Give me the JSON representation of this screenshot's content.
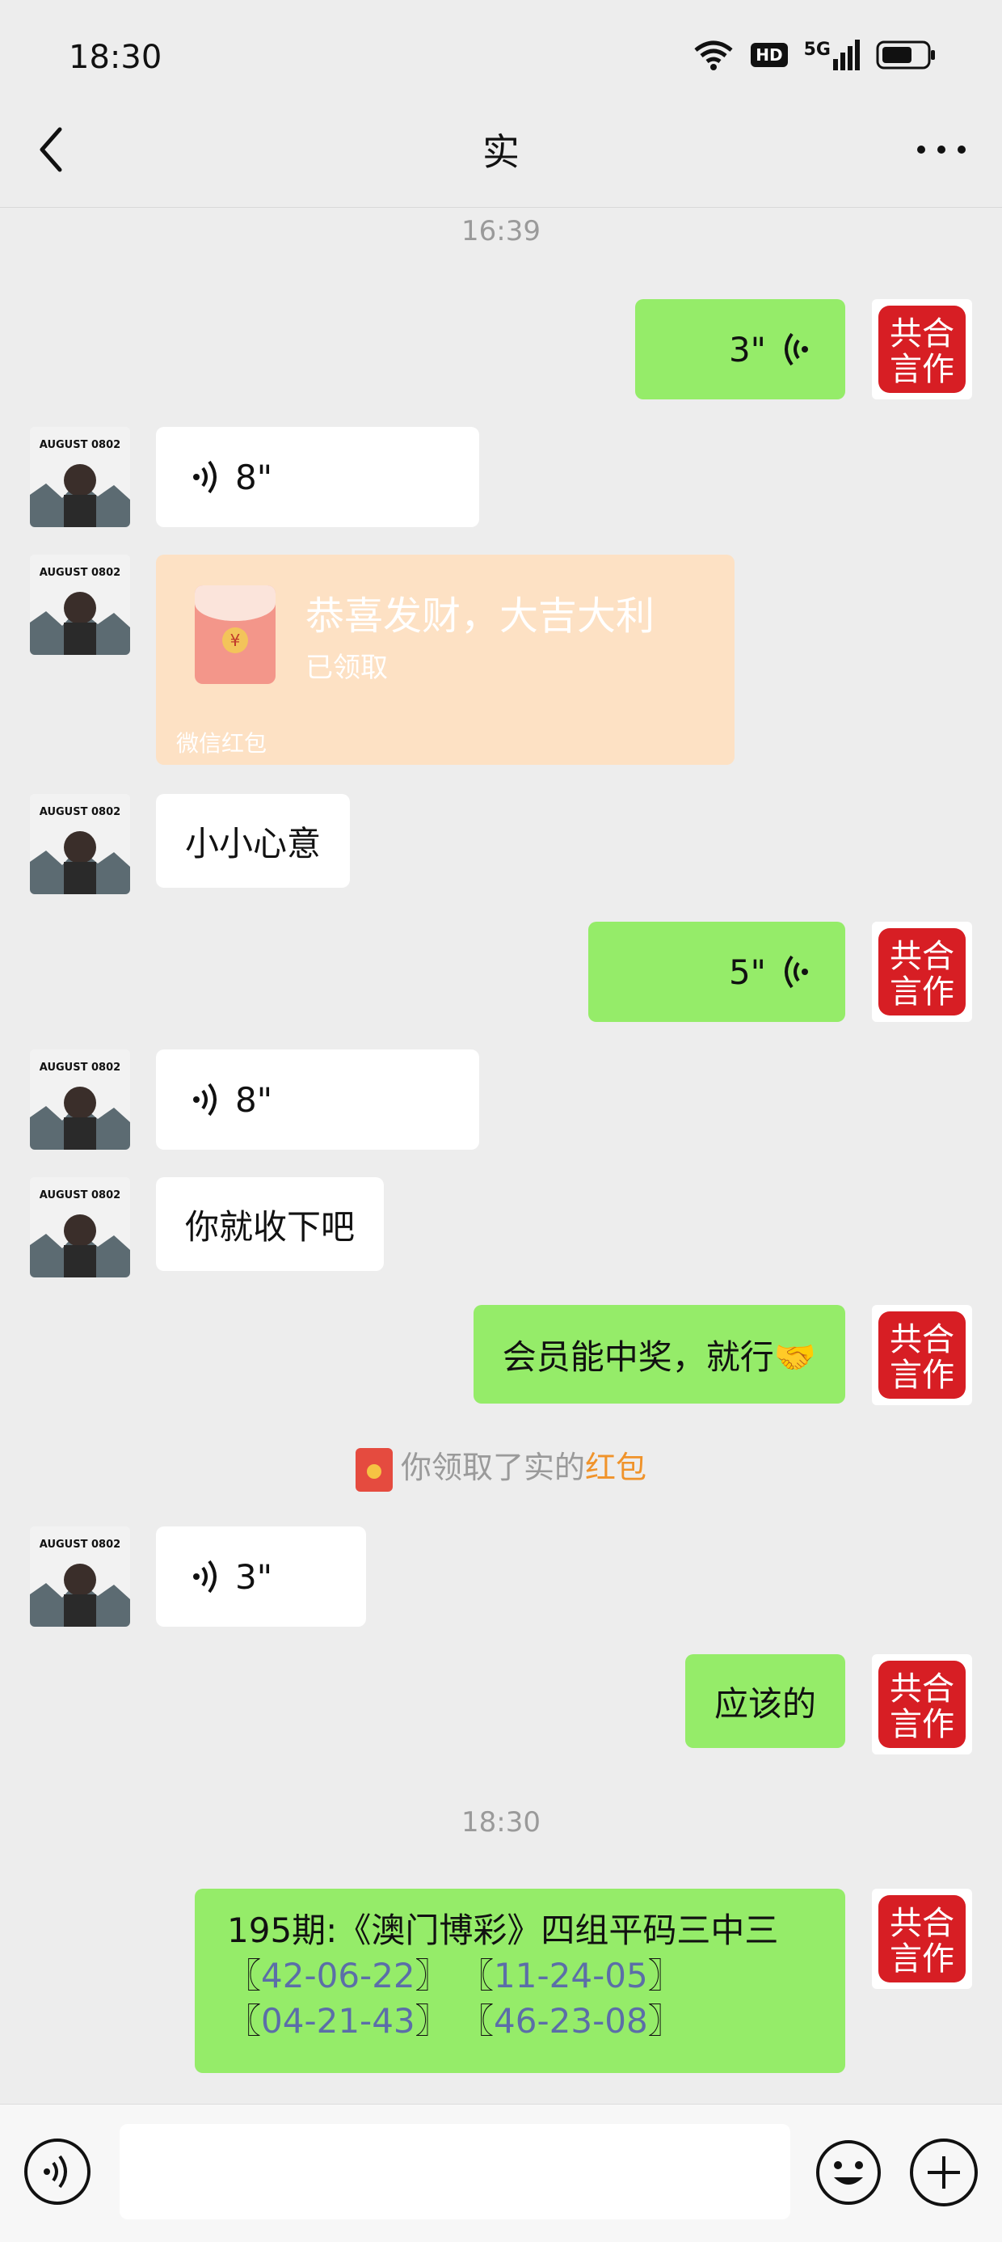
{
  "status_bar": {
    "time": "18:30",
    "hd": "HD",
    "network": "5G"
  },
  "nav": {
    "title": "实"
  },
  "messages": {
    "ts1": "16:39",
    "m1_voice_duration": "3\"",
    "m2_voice_duration": "8\"",
    "redpacket": {
      "title": "恭喜发财，大吉大利",
      "status": "已领取",
      "footer": "微信红包"
    },
    "m4_text": "小小心意",
    "m5_voice_duration": "5\"",
    "m6_voice_duration": "8\"",
    "m7_text": "你就收下吧",
    "m8_text": "会员能中奖，就行🤝",
    "system": {
      "prefix": "你领取了实的",
      "link": "红包"
    },
    "m9_voice_duration": "3\"",
    "m10_text": "应该的",
    "ts2": "18:30",
    "lotto": {
      "line1": "195期:《澳门博彩》四组平码三中三",
      "nums": [
        "42-06-22",
        "11-24-05",
        "04-21-43",
        "46-23-08"
      ],
      "bracket_open": "〖",
      "bracket_close": "〗"
    }
  },
  "avatars": {
    "left_caption": "AUGUST 0802",
    "right_seal_text": "共言合作"
  },
  "colors": {
    "background": "#ededed",
    "sent_bubble": "#95ec69",
    "received_bubble": "#ffffff",
    "red_packet": "#fde1c4",
    "link_orange": "#f0932a",
    "seal_red": "#d71e24"
  },
  "icons": [
    "wifi-icon",
    "hd-icon",
    "signal-icon",
    "battery-icon",
    "back-icon",
    "more-icon",
    "voice-wave-icon",
    "voice-input-icon",
    "emoji-icon",
    "plus-icon",
    "red-envelope-icon"
  ]
}
